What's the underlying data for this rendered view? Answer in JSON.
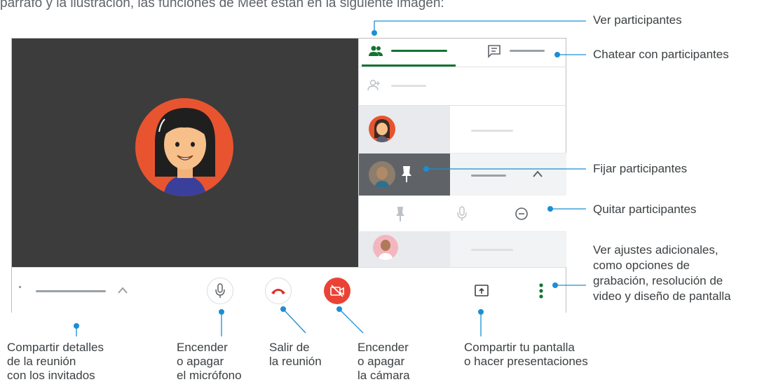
{
  "top_text": "párrafo y la ilustración, las funciones de Meet están en la siguiente imagen:",
  "colors": {
    "accent": "#1a8fd3",
    "video_bg": "#3c3c3c",
    "avatar_orange": "#e8542f",
    "hangup_red": "#d93025",
    "camera_off_red": "#ea4335",
    "tab_green": "#137333"
  },
  "icons": {
    "people_tab": "people-icon",
    "chat_tab": "chat-icon",
    "add_person": "add-person-icon",
    "pin": "pin-icon",
    "mic": "microphone-icon",
    "remove": "remove-circle-icon",
    "chevron": "chevron-up-icon",
    "hangup": "phone-hangup-icon",
    "camera_off": "camera-off-icon",
    "present": "present-screen-icon",
    "more": "more-vert-icon"
  },
  "callouts_right": {
    "view_participants": "Ver participantes",
    "chat_participants": "Chatear con participantes",
    "pin_participants": "Fijar participantes",
    "remove_participants": "Quitar participantes",
    "more_settings": "Ver ajustes adicionales,\ncomo opciones de\ngrabación, resolución de\nvideo y diseño de pantalla"
  },
  "callouts_bottom": {
    "meeting_details": "Compartir detalles\nde la reunión\ncon los invitados",
    "mic": "Encender\no apagar\nel micrófono",
    "leave": "Salir de\nla reunión",
    "camera": "Encender\no apagar\nla cámara",
    "present": "Compartir tu pantalla\no hacer presentaciones"
  }
}
